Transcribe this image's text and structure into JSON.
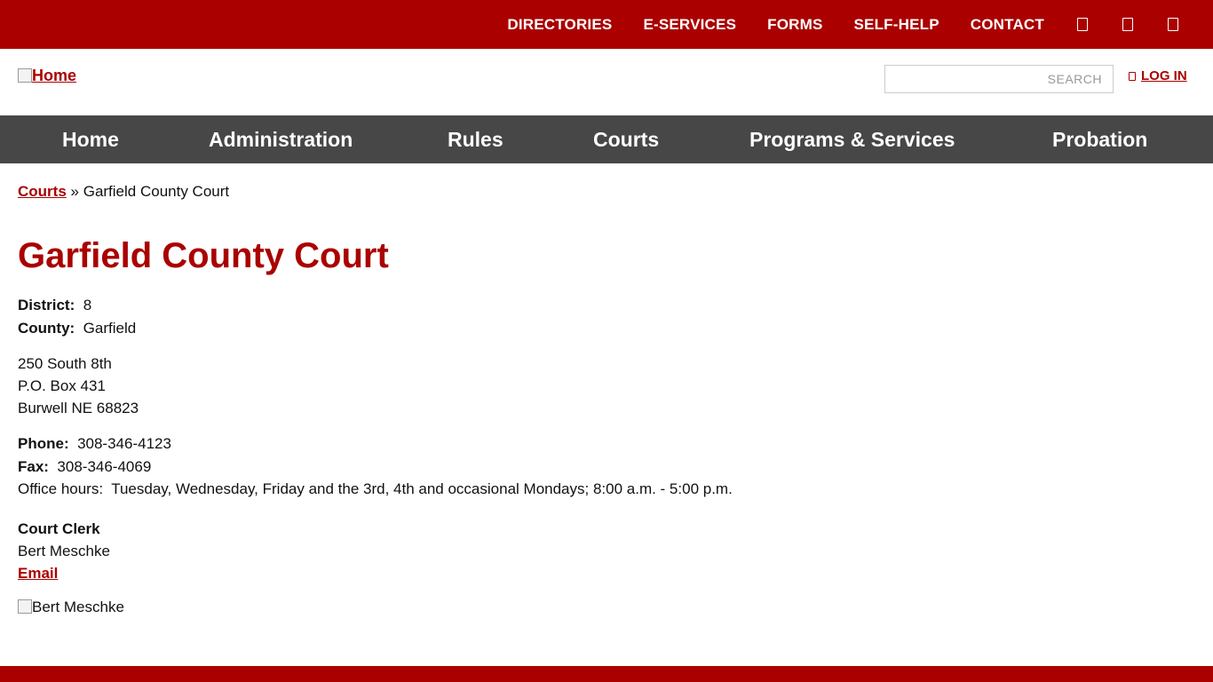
{
  "topbar": {
    "links": [
      "DIRECTORIES",
      "E-SERVICES",
      "FORMS",
      "SELF-HELP",
      "CONTACT"
    ],
    "icons": [
      "facebook-icon",
      "twitter-icon",
      "youtube-icon"
    ]
  },
  "header": {
    "logo_alt": "Home",
    "search_placeholder": "SEARCH",
    "login_label": "LOG IN"
  },
  "nav": {
    "items": [
      "Home",
      "Administration",
      "Rules",
      "Courts",
      "Programs & Services",
      "Probation"
    ]
  },
  "breadcrumb": {
    "parent": "Courts",
    "separator": "»",
    "current": "Garfield County Court"
  },
  "page": {
    "title": "Garfield County Court",
    "district_label": "District:",
    "district": "8",
    "county_label": "County:",
    "county": "Garfield",
    "address": [
      "250 South 8th",
      "P.O. Box 431",
      "Burwell NE 68823"
    ],
    "phone_label": "Phone:",
    "phone": "308-346-4123",
    "fax_label": "Fax:",
    "fax": "308-346-4069",
    "hours_label": "Office hours:",
    "hours": "Tuesday, Wednesday, Friday and the 3rd, 4th and occasional Mondays; 8:00 a.m. - 5:00 p.m.",
    "clerk_title": "Court Clerk",
    "clerk_name": "Bert Meschke",
    "email_label": "Email",
    "photo_alt": "Bert Meschke"
  },
  "colors": {
    "brand_red": "#aa0000",
    "nav_gray": "#474747"
  }
}
